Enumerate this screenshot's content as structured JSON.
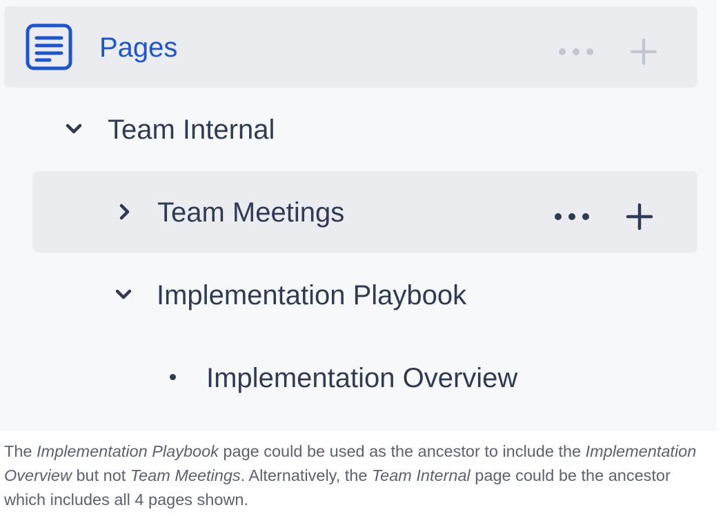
{
  "tree": {
    "root": {
      "title": "Pages",
      "icon": "document-lines-icon",
      "accent": "#1d55d1"
    },
    "items": [
      {
        "label": "Team Internal",
        "state": "expanded",
        "icon": "chevron-down-icon"
      },
      {
        "label": "Team Meetings",
        "state": "collapsed",
        "icon": "chevron-right-icon",
        "hovered": true
      },
      {
        "label": "Implementation Playbook",
        "state": "expanded",
        "icon": "chevron-down-icon"
      },
      {
        "label": "Implementation Overview",
        "state": "leaf",
        "icon": "bullet-icon"
      }
    ],
    "row_actions": {
      "more_icon": "more-horizontal-icon",
      "add_icon": "plus-icon"
    }
  },
  "caption": {
    "part1": "The ",
    "em1": "Implementation Playbook",
    "part2": " page could be used as the ancestor to include the ",
    "em2": "Implementation Overview",
    "part3": " but not ",
    "em3": "Team Meetings",
    "part4": ".  Alternatively, the ",
    "em4": "Team Internal",
    "part5": " page could be the ancestor which includes all 4 pages shown."
  },
  "colors": {
    "panel_bg": "#f7f8fa",
    "hover_bg": "#ebecf0",
    "text": "#2f3b55",
    "muted_icon": "#c1c7d0",
    "caption_text": "#5b6170"
  }
}
